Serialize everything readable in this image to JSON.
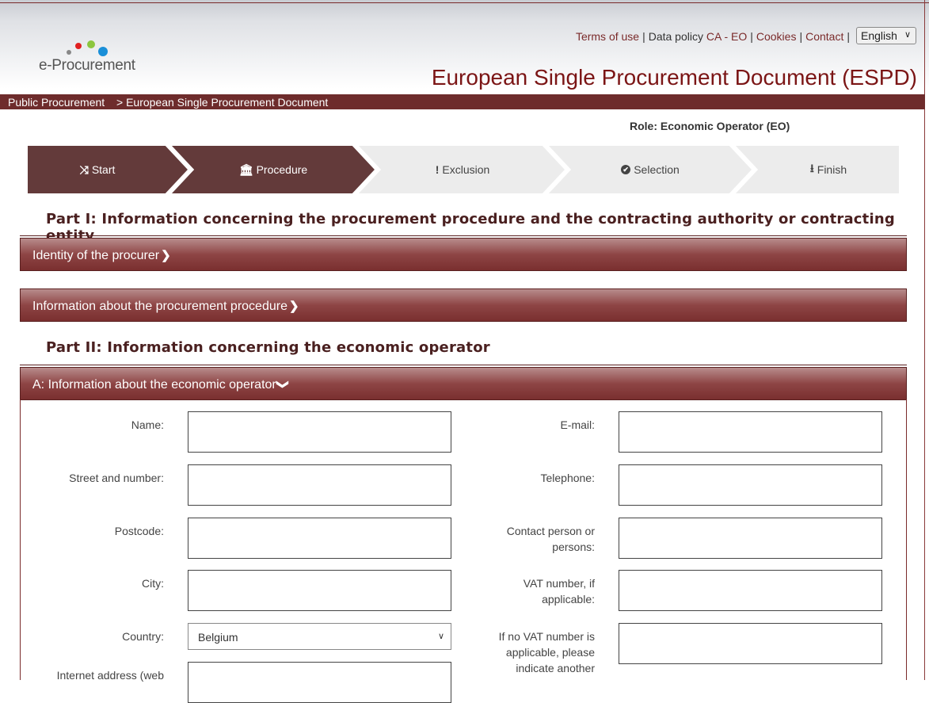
{
  "header": {
    "logo_text": "e-Procurement",
    "links": [
      "Terms of use",
      "Data policy CA - EO",
      "Cookies",
      "Contact"
    ],
    "language": "English",
    "app_title": "European Single Procurement Document (ESPD)"
  },
  "breadcrumb": {
    "home": "Public Procurement",
    "current": "> European Single Procurement Document"
  },
  "role": "Role: Economic Operator (EO)",
  "steps": [
    {
      "label": "Start",
      "icon": "shuffle-icon",
      "glyph": "⤨",
      "state": "done"
    },
    {
      "label": "Procedure",
      "icon": "bank-icon",
      "glyph": "🏛",
      "state": "active"
    },
    {
      "label": "Exclusion",
      "icon": "exclamation-icon",
      "glyph": "!",
      "state": "pending"
    },
    {
      "label": "Selection",
      "icon": "check-circle-icon",
      "glyph": "✔",
      "state": "pending"
    },
    {
      "label": "Finish",
      "icon": "download-icon",
      "glyph": "⬇",
      "state": "pending"
    }
  ],
  "part1_title": "Part I: Information concerning the procurement procedure and the contracting authority or contracting entity",
  "panels": {
    "identity": "Identity of the procurer",
    "procedure": "Information about the procurement procedure",
    "eo_info": "A: Information about the economic operator"
  },
  "part2_title": "Part II: Information concerning the economic operator",
  "form": {
    "name_label": "Name:",
    "street_label": "Street and number:",
    "postcode_label": "Postcode:",
    "city_label": "City:",
    "country_label": "Country:",
    "country_value": "Belgium",
    "internet_label": "Internet address (web",
    "email_label": "E-mail:",
    "telephone_label": "Telephone:",
    "contact_label_1": "Contact person or",
    "contact_label_2": "persons:",
    "vat_label_1": "VAT number, if",
    "vat_label_2": "applicable:",
    "novat_label_1": "If no VAT number is",
    "novat_label_2": "applicable, please",
    "novat_label_3": "indicate another"
  },
  "colors": {
    "brand_dark": "#6e2c2c",
    "title_red": "#7b1515",
    "step_active": "#633a3a",
    "step_pending": "#ececec"
  }
}
